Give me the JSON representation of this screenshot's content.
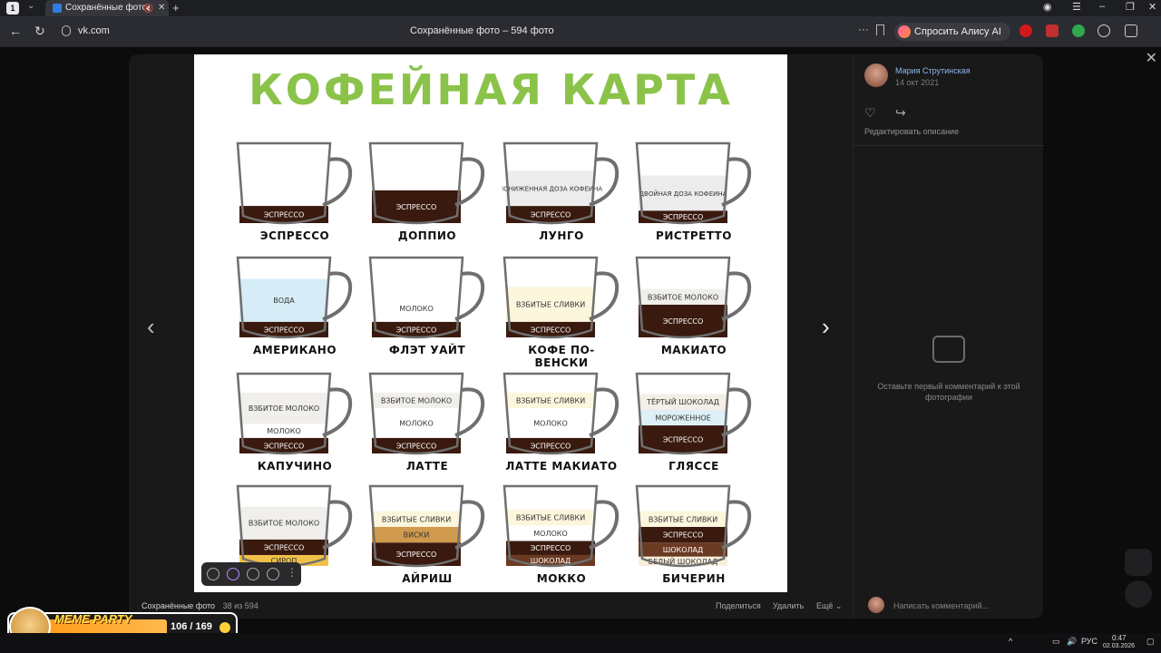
{
  "browser": {
    "tab_count": "1",
    "active_tab_title": "Сохранённые фото",
    "new_tab": "+",
    "url": "vk.com",
    "page_title": "Сохранённые фото – 594 фото",
    "alice_label": "Спросить Алису AI"
  },
  "photo": {
    "title": "КОФЕЙНАЯ КАРТА",
    "cups": [
      {
        "name": "ЭСПРЕССО",
        "layers": [
          {
            "label": "ЭСПРЕССО",
            "color": "#3a1a0e",
            "h": 0.22
          }
        ]
      },
      {
        "name": "ДОППИО",
        "layers": [
          {
            "label": "ЭСПРЕССО",
            "color": "#3a1a0e",
            "h": 0.42
          }
        ]
      },
      {
        "name": "ЛУНГО",
        "layers": [
          {
            "label": "ЭСПРЕССО",
            "color": "#3a1a0e",
            "h": 0.22
          },
          {
            "label": "ПОНИЖЕННАЯ ДОЗА КОФЕИНА",
            "color": "#ececec",
            "h": 0.45
          }
        ]
      },
      {
        "name": "РИСТРЕТТО",
        "layers": [
          {
            "label": "ЭСПРЕССО",
            "color": "#3a1a0e",
            "h": 0.16
          },
          {
            "label": "ДВОЙНАЯ ДОЗА КОФЕИНА",
            "color": "#ececec",
            "h": 0.45
          }
        ]
      },
      {
        "name": "АМЕРИКАНО",
        "layers": [
          {
            "label": "ЭСПРЕССО",
            "color": "#3a1a0e",
            "h": 0.2
          },
          {
            "label": "ВОДА",
            "color": "#d6ecf7",
            "h": 0.55
          }
        ]
      },
      {
        "name": "ФЛЭТ УАЙТ",
        "layers": [
          {
            "label": "ЭСПРЕССО",
            "color": "#3a1a0e",
            "h": 0.2
          },
          {
            "label": "МОЛОКО",
            "color": "#ffffff",
            "h": 0.35
          }
        ]
      },
      {
        "name": "КОФЕ ПО-ВЕНСКИ",
        "layers": [
          {
            "label": "ЭСПРЕССО",
            "color": "#3a1a0e",
            "h": 0.2
          },
          {
            "label": "ВЗБИТЫЕ СЛИВКИ",
            "color": "#fbf6dc",
            "h": 0.45
          }
        ]
      },
      {
        "name": "МАКИАТО",
        "layers": [
          {
            "label": "ЭСПРЕССО",
            "color": "#3a1a0e",
            "h": 0.42
          },
          {
            "label": "ВЗБИТОЕ МОЛОКО",
            "color": "#f1efec",
            "h": 0.2
          }
        ]
      },
      {
        "name": "КАПУЧИНО",
        "layers": [
          {
            "label": "ЭСПРЕССО",
            "color": "#3a1a0e",
            "h": 0.2
          },
          {
            "label": "МОЛОКО",
            "color": "#ffffff",
            "h": 0.18
          },
          {
            "label": "ВЗБИТОЕ МОЛОКО",
            "color": "#f1efec",
            "h": 0.4
          }
        ]
      },
      {
        "name": "ЛАТТЕ",
        "layers": [
          {
            "label": "ЭСПРЕССО",
            "color": "#3a1a0e",
            "h": 0.2
          },
          {
            "label": "МОЛОКО",
            "color": "#ffffff",
            "h": 0.38
          },
          {
            "label": "ВЗБИТОЕ МОЛОКО",
            "color": "#f1efec",
            "h": 0.2
          }
        ]
      },
      {
        "name": "ЛАТТЕ МАКИАТО",
        "layers": [
          {
            "label": "ЭСПРЕССО",
            "color": "#3a1a0e",
            "h": 0.2
          },
          {
            "label": "МОЛОКО",
            "color": "#ffffff",
            "h": 0.38
          },
          {
            "label": "ВЗБИТЫЕ СЛИВКИ",
            "color": "#fbf6dc",
            "h": 0.2
          }
        ]
      },
      {
        "name": "ГЛЯССЕ",
        "layers": [
          {
            "label": "ЭСПРЕССО",
            "color": "#3a1a0e",
            "h": 0.36
          },
          {
            "label": "МОРОЖЕННОЕ",
            "color": "#dcf0f5",
            "h": 0.2
          },
          {
            "label": "ТЁРТЫЙ ШОКОЛАД",
            "color": "#f3eee6",
            "h": 0.2
          }
        ]
      },
      {
        "name": "",
        "layers": [
          {
            "label": "СИРОП",
            "color": "#f0c048",
            "h": 0.14
          },
          {
            "label": "ЭСПРЕССО",
            "color": "#3a1a0e",
            "h": 0.2
          },
          {
            "label": "ВЗБИТОЕ МОЛОКО",
            "color": "#f1efec",
            "h": 0.42
          }
        ]
      },
      {
        "name": "АЙРИШ",
        "layers": [
          {
            "label": "ЭСПРЕССО",
            "color": "#3a1a0e",
            "h": 0.3
          },
          {
            "label": "ВИСКИ",
            "color": "#d09a4e",
            "h": 0.2
          },
          {
            "label": "ВЗБИТЫЕ СЛИВКИ",
            "color": "#fbf6dc",
            "h": 0.2
          }
        ]
      },
      {
        "name": "МОККО",
        "layers": [
          {
            "label": "ШОКОЛАД",
            "color": "#6b3a22",
            "h": 0.14
          },
          {
            "label": "ЭСПРЕССО",
            "color": "#3a1a0e",
            "h": 0.18
          },
          {
            "label": "МОЛОКО",
            "color": "#ffffff",
            "h": 0.2
          },
          {
            "label": "ВЗБИТЫЕ СЛИВКИ",
            "color": "#fbf6dc",
            "h": 0.2
          }
        ]
      },
      {
        "name": "БИЧЕРИН",
        "layers": [
          {
            "label": "БЕЛЫЙ ШОКОЛАД",
            "color": "#f7efdc",
            "h": 0.12
          },
          {
            "label": "ШОКОЛАД",
            "color": "#6b3a22",
            "h": 0.18
          },
          {
            "label": "ЭСПРЕССО",
            "color": "#3a1a0e",
            "h": 0.2
          },
          {
            "label": "ВЗБИТЫЕ СЛИВКИ",
            "color": "#fbf6dc",
            "h": 0.2
          }
        ]
      }
    ]
  },
  "viewer": {
    "album": "Сохранённые фото",
    "counter": "38 из 594",
    "share": "Поделиться",
    "delete": "Удалить",
    "more": "Ещё"
  },
  "side": {
    "author": "Мария Струтинская",
    "date": "14 окт 2021",
    "edit_desc": "Редактировать описание",
    "empty_comments": "Оставьте первый комментарий к этой фотографии",
    "comment_placeholder": "Написать комментарий..."
  },
  "overlay": {
    "meme_title": "MEME PARTY",
    "meme_count": "106 / 169"
  },
  "taskbar": {
    "lang": "РУС",
    "time": "0:47",
    "date": "02.03.2026"
  }
}
